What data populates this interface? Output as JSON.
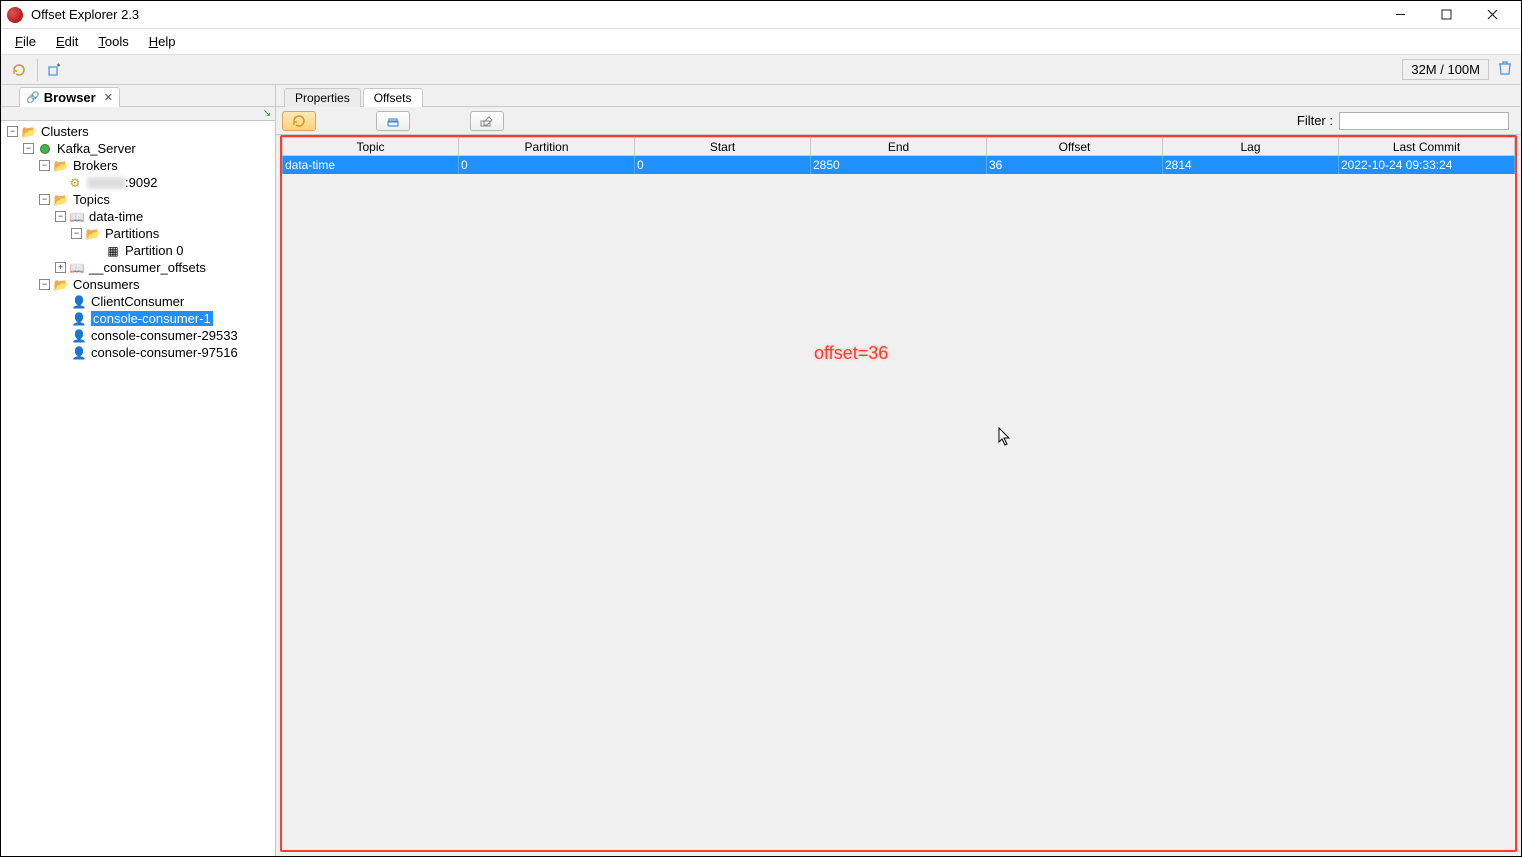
{
  "app": {
    "title": "Offset Explorer  2.3"
  },
  "menu": {
    "file": "File",
    "edit": "Edit",
    "tools": "Tools",
    "help": "Help"
  },
  "toolbar": {
    "memory": "32M / 100M"
  },
  "sidebar": {
    "tab_label": "Browser",
    "root": "Clusters",
    "cluster": "Kafka_Server",
    "brokers": "Brokers",
    "broker_port": ":9092",
    "topics": "Topics",
    "topic_data_time": "data-time",
    "partitions": "Partitions",
    "partition0": "Partition 0",
    "consumer_offsets": "__consumer_offsets",
    "consumers": "Consumers",
    "c1": "ClientConsumer",
    "c2": "console-consumer-1",
    "c3": "console-consumer-29533",
    "c4": "console-consumer-97516"
  },
  "tabs": {
    "properties": "Properties",
    "offsets": "Offsets"
  },
  "filter_label": "Filter :",
  "table": {
    "headers": [
      "Topic",
      "Partition",
      "Start",
      "End",
      "Offset",
      "Lag",
      "Last Commit"
    ],
    "row": [
      "data-time",
      "0",
      "0",
      "2850",
      "36",
      "2814",
      "2022-10-24 09:33:24"
    ]
  },
  "annotation": "offset=36"
}
